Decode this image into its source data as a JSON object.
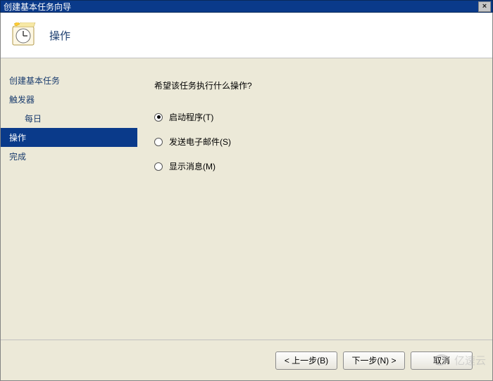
{
  "window": {
    "title": "创建基本任务向导",
    "close_label": "×"
  },
  "banner": {
    "title": "操作"
  },
  "sidebar": {
    "items": [
      {
        "label": "创建基本任务",
        "indent": false,
        "active": false
      },
      {
        "label": "触发器",
        "indent": false,
        "active": false
      },
      {
        "label": "每日",
        "indent": true,
        "active": false
      },
      {
        "label": "操作",
        "indent": false,
        "active": true
      },
      {
        "label": "完成",
        "indent": false,
        "active": false
      }
    ]
  },
  "main": {
    "question": "希望该任务执行什么操作?",
    "options": [
      {
        "label": "启动程序(T)",
        "checked": true
      },
      {
        "label": "发送电子邮件(S)",
        "checked": false
      },
      {
        "label": "显示消息(M)",
        "checked": false
      }
    ]
  },
  "buttons": {
    "back": "< 上一步(B)",
    "next": "下一步(N) >",
    "cancel": "取消"
  },
  "watermark": {
    "text": "亿速云"
  }
}
